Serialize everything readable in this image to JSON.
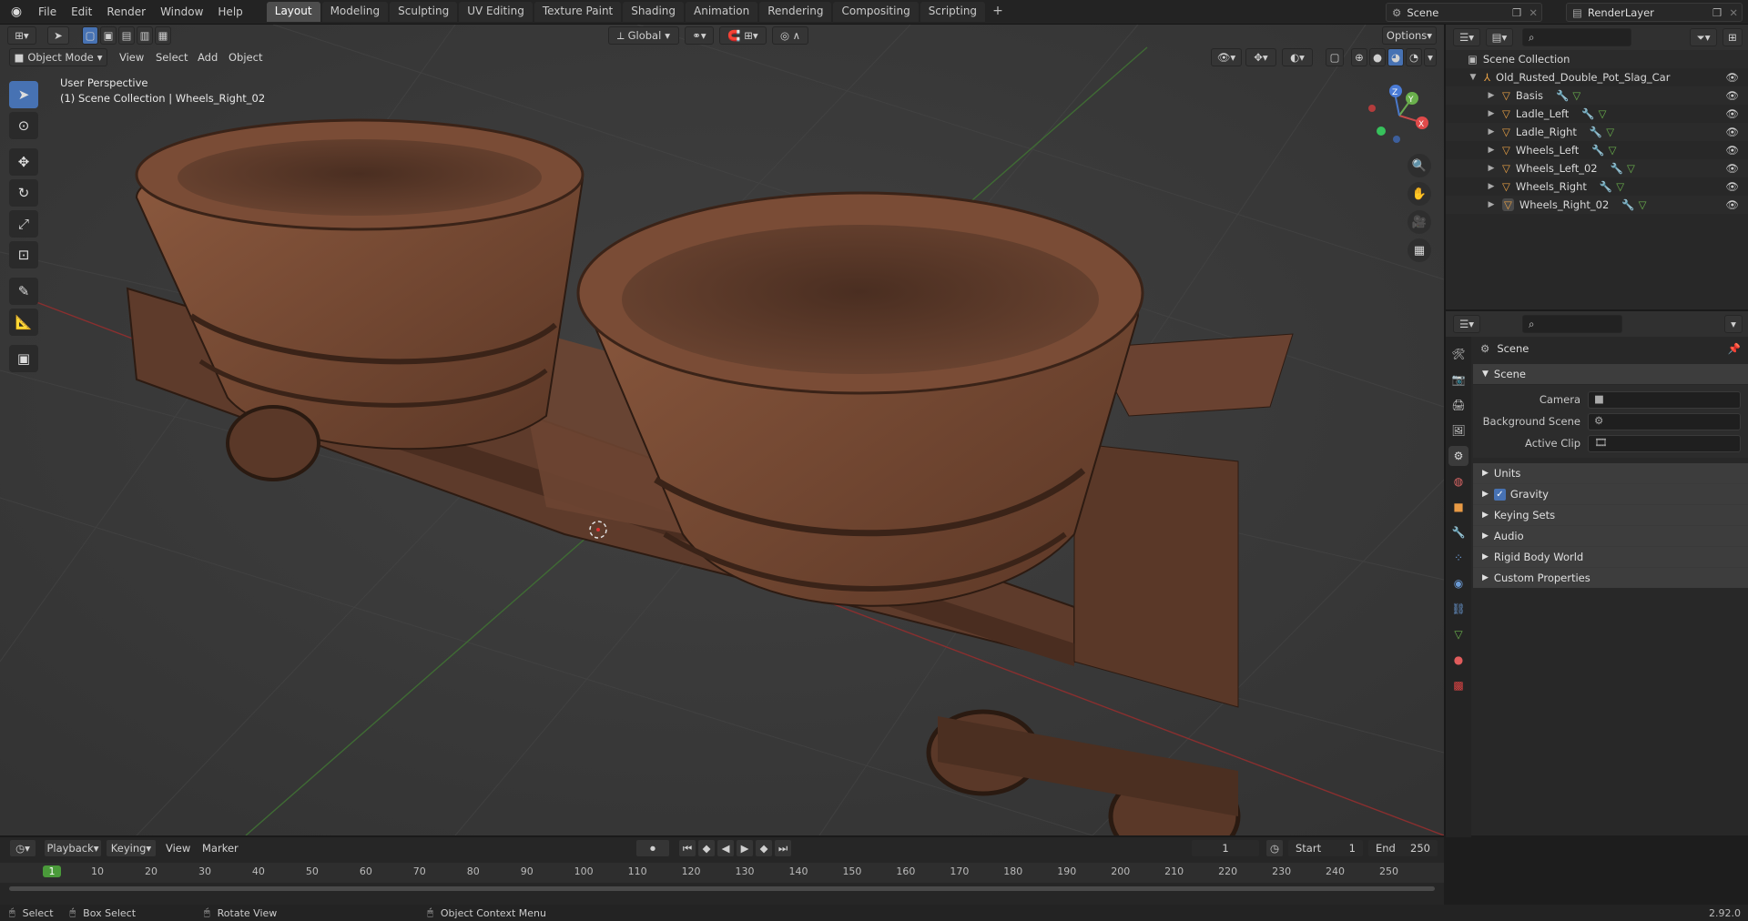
{
  "menu": {
    "file": "File",
    "edit": "Edit",
    "render": "Render",
    "window": "Window",
    "help": "Help"
  },
  "workspaces": [
    "Layout",
    "Modeling",
    "Sculpting",
    "UV Editing",
    "Texture Paint",
    "Shading",
    "Animation",
    "Rendering",
    "Compositing",
    "Scripting"
  ],
  "scene_name": "Scene",
  "view_layer_name": "RenderLayer",
  "viewport": {
    "mode": "Object Mode",
    "menus": [
      "View",
      "Select",
      "Add",
      "Object"
    ],
    "transform_orientation": "Global",
    "options_label": "Options",
    "perspective_label": "User Perspective",
    "collection_label": "(1) Scene Collection | Wheels_Right_02",
    "gizmo_axes": {
      "x": "X",
      "y": "Y",
      "z": "Z"
    }
  },
  "outliner": {
    "root": "Scene Collection",
    "parent": "Old_Rusted_Double_Pot_Slag_Car",
    "children": [
      "Basis",
      "Ladle_Left",
      "Ladle_Right",
      "Wheels_Left",
      "Wheels_Left_02",
      "Wheels_Right",
      "Wheels_Right_02"
    ]
  },
  "properties": {
    "header": "Scene",
    "panel": "Scene",
    "camera_label": "Camera",
    "background_scene_label": "Background Scene",
    "active_clip_label": "Active Clip",
    "subpanels": [
      "Units",
      "Gravity",
      "Keying Sets",
      "Audio",
      "Rigid Body World",
      "Custom Properties"
    ]
  },
  "timeline": {
    "menus": [
      "Playback",
      "Keying",
      "View",
      "Marker"
    ],
    "current_frame": "1",
    "start_label": "Start",
    "start_value": "1",
    "end_label": "End",
    "end_value": "250",
    "ticks": [
      "1",
      "10",
      "20",
      "30",
      "40",
      "50",
      "60",
      "70",
      "80",
      "90",
      "100",
      "110",
      "120",
      "130",
      "140",
      "150",
      "160",
      "170",
      "180",
      "190",
      "200",
      "210",
      "220",
      "230",
      "240",
      "250"
    ]
  },
  "statusbar": {
    "select": "Select",
    "box_select": "Box Select",
    "rotate_view": "Rotate View",
    "context_menu": "Object Context Menu",
    "version": "2.92.0"
  },
  "colors": {
    "accent": "#4772b3",
    "rust": "#7a4a33",
    "grid_red": "#8a2f2f",
    "grid_green": "#3f6b34",
    "frame_green": "#4a9a3a"
  }
}
